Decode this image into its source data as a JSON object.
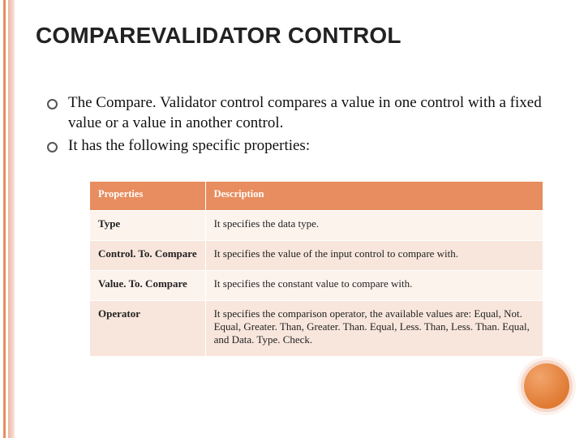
{
  "title": "COMPAREVALIDATOR CONTROL",
  "bullets": [
    "The Compare. Validator control compares a value in one control with a fixed value or a value in another control.",
    "It has the following specific properties:"
  ],
  "table": {
    "headers": {
      "col0": "Properties",
      "col1": "Description"
    },
    "rows": [
      {
        "prop": "Type",
        "desc": "It specifies the data type."
      },
      {
        "prop": "Control. To. Compare",
        "desc": "It specifies the value of the input control to compare with."
      },
      {
        "prop": "Value. To. Compare",
        "desc": "It specifies the constant value to compare with."
      },
      {
        "prop": "Operator",
        "desc": "It specifies the comparison operator, the available values are: Equal, Not. Equal, Greater. Than, Greater. Than. Equal, Less. Than, Less. Than. Equal, and Data. Type. Check."
      }
    ]
  },
  "chart_data": {
    "type": "table",
    "title": "CompareValidator specific properties",
    "columns": [
      "Properties",
      "Description"
    ],
    "rows": [
      [
        "Type",
        "It specifies the data type."
      ],
      [
        "Control. To. Compare",
        "It specifies the value of the input control to compare with."
      ],
      [
        "Value. To. Compare",
        "It specifies the constant value to compare with."
      ],
      [
        "Operator",
        "It specifies the comparison operator, the available values are: Equal, Not. Equal, Greater. Than, Greater. Than. Equal, Less. Than, Less. Than. Equal, and Data. Type. Check."
      ]
    ]
  }
}
